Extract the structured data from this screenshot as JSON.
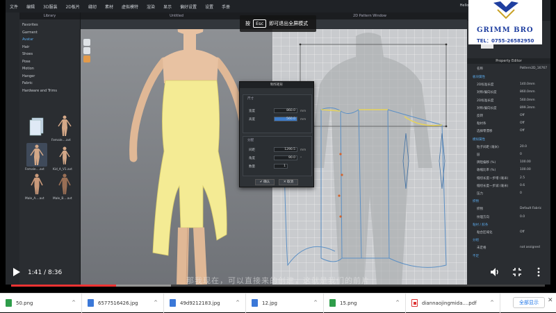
{
  "app": {
    "menu": [
      "文件",
      "编辑",
      "3D服装",
      "2D板片",
      "缝纫",
      "素材",
      "虚拟模特",
      "渲染",
      "显示",
      "偏好设置",
      "设置",
      "手册"
    ],
    "user_greeting": "Hello, grimmbro",
    "simulation_badge": "SIMULATE"
  },
  "library": {
    "title": "Library",
    "categories": [
      "Favorites",
      "Garment",
      "Avatar",
      "Hair",
      "Shoes",
      "Pose",
      "Motion",
      "Hanger",
      "Fabric",
      "Hardware and Trims"
    ],
    "active_category": "Avatar",
    "items": [
      {
        "label": ""
      },
      {
        "label": "Female....avt"
      },
      {
        "label": "Female....avt"
      },
      {
        "label": "Kid_A_V1.avt"
      },
      {
        "label": "Male_A....avt"
      },
      {
        "label": "Male_B....avt"
      }
    ]
  },
  "viewport3d": {
    "title": "Untitled"
  },
  "viewport2d": {
    "title": "2D Pattern Window"
  },
  "esc_hint": {
    "prefix": "按",
    "key": "Esc",
    "suffix": "即可退出全屏模式"
  },
  "dialog": {
    "title": "制作矩形",
    "group1_title": "尺寸",
    "width_label": "宽度",
    "width_value": "860.0",
    "width_unit": "mm",
    "height_label": "高度",
    "height_value": "560.0",
    "height_unit": "mm",
    "group2_title": "分配",
    "spacing_label": "间距",
    "spacing_value": "1290.5",
    "spacing_unit": "mm",
    "angle_label": "角度",
    "angle_value": "90.0",
    "angle_unit": "°",
    "count_label": "数量",
    "count_value": "1",
    "ok_label": "确认",
    "cancel_label": "取消"
  },
  "properties": {
    "tabs": [
      "信息",
      "材质",
      "2D",
      "3D"
    ],
    "title": "Property Editor",
    "name_label": "名称",
    "name_value": "Pattern2D_16767",
    "rows": [
      {
        "k": "板块属性",
        "v": "",
        "section": true
      },
      {
        "k": "2D标准长度",
        "v": "140.0mm"
      },
      {
        "k": "对称/偏向长度",
        "v": "860.0mm"
      },
      {
        "k": "2D标准长度",
        "v": "560.0mm"
      },
      {
        "k": "对称/偏向长度",
        "v": "899.3mm"
      },
      {
        "k": "反转",
        "v": "Off"
      },
      {
        "k": "粘衬条",
        "v": "Off"
      },
      {
        "k": "选择零漂移",
        "v": "Off"
      },
      {
        "k": "模拟属性",
        "v": "",
        "section": true
      },
      {
        "k": "粒子间距 (毫米)",
        "v": "20.0"
      },
      {
        "k": "层",
        "v": "0"
      },
      {
        "k": "牌阻偏移 (%)",
        "v": "100.00"
      },
      {
        "k": "收缩比率 (%)",
        "v": "100.00"
      },
      {
        "k": "缝纫长度一步增 (毫米)",
        "v": "2.5"
      },
      {
        "k": "缝纫长度一步减 (毫米)",
        "v": "0.6"
      },
      {
        "k": "压力",
        "v": "0"
      },
      {
        "k": "织物",
        "v": "",
        "section": true
      },
      {
        "k": "织物",
        "v": "Default Fabric"
      },
      {
        "k": "纹理方向",
        "v": "0.0"
      },
      {
        "k": "粘衬 / 胶条",
        "v": "",
        "section": true
      },
      {
        "k": "粘合区域化",
        "v": "Off"
      },
      {
        "k": "分组",
        "v": "",
        "section": true
      },
      {
        "k": "未定格",
        "v": "not assigned"
      },
      {
        "k": "不足",
        "v": "",
        "section": true
      }
    ]
  },
  "subtitle": "那我现在，可以直接来的创建，这就是我们的前片",
  "video": {
    "current_time": "1:41",
    "duration": "8:36",
    "time_display": "1:41 / 8:36",
    "progress": 0.196
  },
  "logo": {
    "name": "GRIMM BRO",
    "tel": "TEL：0755-26582950"
  },
  "downloads": [
    {
      "name": "50.png",
      "type": "png"
    },
    {
      "name": "6577516426.jpg",
      "type": "jpg"
    },
    {
      "name": "49d9212183.jpg",
      "type": "jpg"
    },
    {
      "name": "12.jpg",
      "type": "jpg"
    },
    {
      "name": "15.png",
      "type": "png"
    },
    {
      "name": "diannaojingmida....pdf",
      "type": "pdf"
    }
  ],
  "download_bar": {
    "show_all_label": "全部显示"
  }
}
